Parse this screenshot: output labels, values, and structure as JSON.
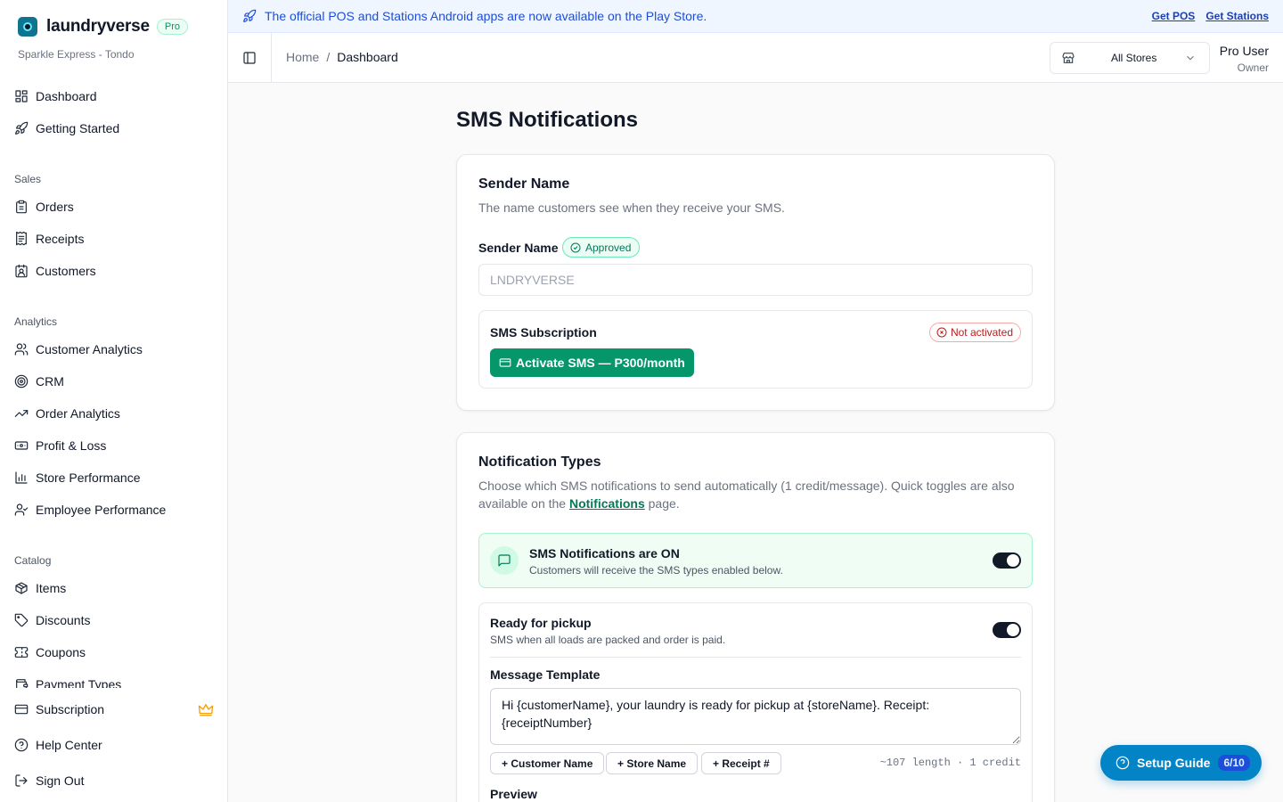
{
  "brand": {
    "name": "laundryverse",
    "badge": "Pro",
    "store": "Sparkle Express - Tondo"
  },
  "sidebar": {
    "top_items": [
      {
        "label": "Dashboard",
        "icon": "layout-grid-icon"
      },
      {
        "label": "Getting Started",
        "icon": "rocket-icon"
      }
    ],
    "sections": [
      {
        "title": "Sales",
        "items": [
          {
            "label": "Orders",
            "icon": "clipboard-icon"
          },
          {
            "label": "Receipts",
            "icon": "receipt-icon"
          },
          {
            "label": "Customers",
            "icon": "contact-icon"
          }
        ]
      },
      {
        "title": "Analytics",
        "items": [
          {
            "label": "Customer Analytics",
            "icon": "users-icon"
          },
          {
            "label": "CRM",
            "icon": "target-icon"
          },
          {
            "label": "Order Analytics",
            "icon": "trending-up-icon"
          },
          {
            "label": "Profit & Loss",
            "icon": "banknote-icon"
          },
          {
            "label": "Store Performance",
            "icon": "bar-chart-icon"
          },
          {
            "label": "Employee Performance",
            "icon": "user-check-icon"
          }
        ]
      },
      {
        "title": "Catalog",
        "items": [
          {
            "label": "Items",
            "icon": "package-icon"
          },
          {
            "label": "Discounts",
            "icon": "tag-icon"
          },
          {
            "label": "Coupons",
            "icon": "ticket-icon"
          },
          {
            "label": "Payment Types",
            "icon": "wallet-icon"
          }
        ]
      }
    ],
    "bottom_items": [
      {
        "label": "Subscription",
        "icon": "credit-card-icon"
      },
      {
        "label": "Help Center",
        "icon": "help-circle-icon"
      },
      {
        "label": "Sign Out",
        "icon": "log-out-icon"
      }
    ]
  },
  "banner": {
    "message": "The official POS and Stations Android apps are now available on the Play Store.",
    "link_pos": "Get POS",
    "link_stations": "Get Stations"
  },
  "header": {
    "breadcrumb_home": "Home",
    "breadcrumb_sep": "/",
    "breadcrumb_current": "Dashboard",
    "store_selector": "All Stores",
    "user_name": "Pro User",
    "user_role": "Owner"
  },
  "page": {
    "title": "SMS Notifications",
    "sender": {
      "heading": "Sender Name",
      "description": "The name customers see when they receive your SMS.",
      "field_label": "Sender Name",
      "status": "Approved",
      "value": "LNDRYVERSE",
      "subscription_title": "SMS Subscription",
      "subscription_status": "Not activated",
      "activate_label": "Activate SMS — P300/month"
    },
    "notification_types": {
      "heading": "Notification Types",
      "desc_before": "Choose which SMS notifications to send automatically (1 credit/message). Quick toggles are also available on the ",
      "desc_link": "Notifications",
      "desc_after": " page.",
      "master_title": "SMS Notifications are ON",
      "master_sub": "Customers will receive the SMS types enabled below.",
      "master_on": true,
      "pickup_title": "Ready for pickup",
      "pickup_sub": "SMS when all loads are packed and order is paid.",
      "pickup_on": true,
      "template_label": "Message Template",
      "template_value": "Hi {customerName}, your laundry is ready for pickup at {storeName}. Receipt: {receiptNumber}",
      "chips": [
        "+ Customer Name",
        "+ Store Name",
        "+ Receipt #"
      ],
      "length_info": "~107 length · 1 credit",
      "preview_label": "Preview"
    }
  },
  "setup_guide": {
    "label": "Setup Guide",
    "progress": "6/10"
  },
  "colors": {
    "accent": "#059669",
    "banner_text": "#1d4ed8",
    "setup_button": "#0284c7"
  }
}
